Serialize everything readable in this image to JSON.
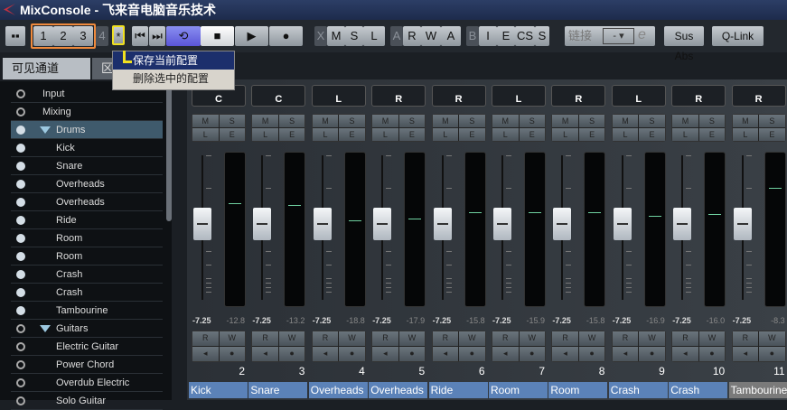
{
  "title": "MixConsole - 飞来音电脑音乐技术",
  "toolbar": {
    "configs": [
      "1",
      "2",
      "3",
      "4",
      "*"
    ],
    "group1": [
      "X",
      "M",
      "S",
      "L"
    ],
    "group2": [
      "A",
      "R",
      "W",
      "A"
    ],
    "group3": [
      "B",
      "I",
      "E",
      "CS",
      "S"
    ],
    "link_label": "链接",
    "link_value": "-",
    "sus_abs": "Sus Abs",
    "qlink": "Q-Link"
  },
  "menu": {
    "items": [
      "保存当前配置",
      "删除选中的配置"
    ]
  },
  "tabs": [
    "可见通道",
    "区"
  ],
  "channel_list": [
    {
      "label": "Input",
      "filled": false,
      "folder": false,
      "indent": false
    },
    {
      "label": "Mixing",
      "filled": false,
      "folder": false,
      "indent": false
    },
    {
      "label": "Drums",
      "filled": true,
      "folder": true,
      "indent": true,
      "selected": true
    },
    {
      "label": "Kick",
      "filled": true,
      "indent": true
    },
    {
      "label": "Snare",
      "filled": true,
      "indent": true
    },
    {
      "label": "Overheads",
      "filled": true,
      "indent": true
    },
    {
      "label": "Overheads",
      "filled": true,
      "indent": true
    },
    {
      "label": "Ride",
      "filled": true,
      "indent": true
    },
    {
      "label": "Room",
      "filled": true,
      "indent": true
    },
    {
      "label": "Room",
      "filled": true,
      "indent": true
    },
    {
      "label": "Crash",
      "filled": true,
      "indent": true
    },
    {
      "label": "Crash",
      "filled": true,
      "indent": true
    },
    {
      "label": "Tambourine",
      "filled": true,
      "indent": true
    },
    {
      "label": "Guitars",
      "filled": false,
      "folder": true,
      "indent": true
    },
    {
      "label": "Electric Guitar",
      "filled": false,
      "indent": true
    },
    {
      "label": "Power Chord",
      "filled": false,
      "indent": true
    },
    {
      "label": "Overdub Electric",
      "filled": false,
      "indent": true
    },
    {
      "label": "Solo Guitar",
      "filled": false,
      "indent": true
    }
  ],
  "channels": [
    {
      "num": "2",
      "name": "Kick",
      "pan": "C",
      "fader": "-7.25",
      "peak": "-12.8",
      "meter_peak": 0.67
    },
    {
      "num": "3",
      "name": "Snare",
      "pan": "C",
      "fader": "-7.25",
      "peak": "-13.2",
      "meter_peak": 0.66
    },
    {
      "num": "4",
      "name": "Overheads",
      "pan": "L",
      "fader": "-7.25",
      "peak": "-18.8",
      "meter_peak": 0.56
    },
    {
      "num": "5",
      "name": "Overheads",
      "pan": "R",
      "fader": "-7.25",
      "peak": "-17.9",
      "meter_peak": 0.57
    },
    {
      "num": "6",
      "name": "Ride",
      "pan": "R",
      "fader": "-7.25",
      "peak": "-15.8",
      "meter_peak": 0.61
    },
    {
      "num": "7",
      "name": "Room",
      "pan": "L",
      "fader": "-7.25",
      "peak": "-15.9",
      "meter_peak": 0.61
    },
    {
      "num": "8",
      "name": "Room",
      "pan": "R",
      "fader": "-7.25",
      "peak": "-15.8",
      "meter_peak": 0.61
    },
    {
      "num": "9",
      "name": "Crash",
      "pan": "L",
      "fader": "-7.25",
      "peak": "-16.9",
      "meter_peak": 0.59
    },
    {
      "num": "10",
      "name": "Crash",
      "pan": "R",
      "fader": "-7.25",
      "peak": "-16.0",
      "meter_peak": 0.6
    },
    {
      "num": "11",
      "name": "Tambourine",
      "pan": "R",
      "fader": "-7.25",
      "peak": "-8.3",
      "meter_peak": 0.77
    }
  ],
  "strip_buttons": {
    "m": "M",
    "s": "S",
    "l": "L",
    "e": "E",
    "r": "R",
    "w": "W"
  }
}
